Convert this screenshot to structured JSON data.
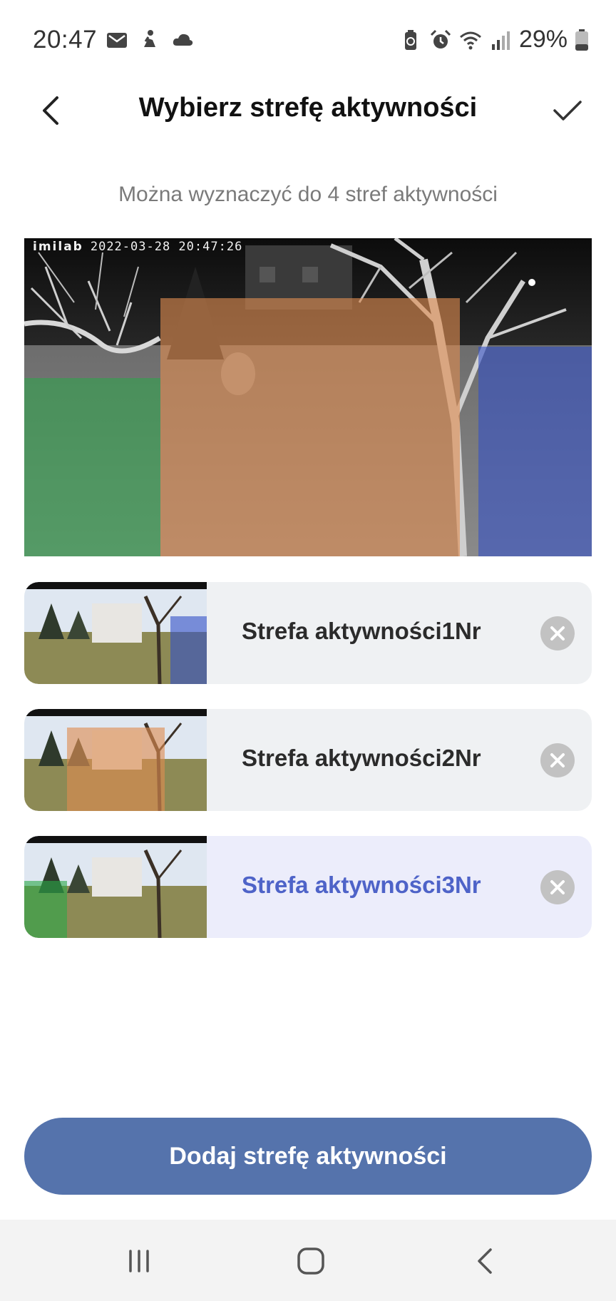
{
  "status_bar": {
    "time": "20:47",
    "battery": "29%",
    "left_icons": [
      "mail-icon",
      "activity-icon",
      "cloud-icon"
    ],
    "right_icons": [
      "battery-saver-icon",
      "alarm-icon",
      "wifi-icon",
      "signal-icon",
      "battery-icon"
    ]
  },
  "header": {
    "title": "Wybierz strefę aktywności"
  },
  "hint": "Można wyznaczyć do 4 stref aktywności",
  "preview": {
    "camera_logo": "imilab",
    "timestamp": "2022-03-28 20:47:26",
    "zone_colors": {
      "green": "#2aa848",
      "orange": "#de8c50",
      "blue": "#3250c8"
    }
  },
  "zones": [
    {
      "name": "Strefa aktywności1Nr",
      "color": "blue",
      "selected": false
    },
    {
      "name": "Strefa aktywności2Nr",
      "color": "orange",
      "selected": false
    },
    {
      "name": "Strefa aktywności3Nr",
      "color": "green",
      "selected": true
    }
  ],
  "add_button_label": "Dodaj strefę aktywności",
  "nav_bar": {
    "buttons": [
      "recent-apps-icon",
      "home-icon",
      "back-icon"
    ]
  },
  "colors": {
    "accent": "#5573ac",
    "selected_text": "#4e63c8",
    "selected_bg": "#ecedfb",
    "item_bg": "#eff1f3"
  }
}
